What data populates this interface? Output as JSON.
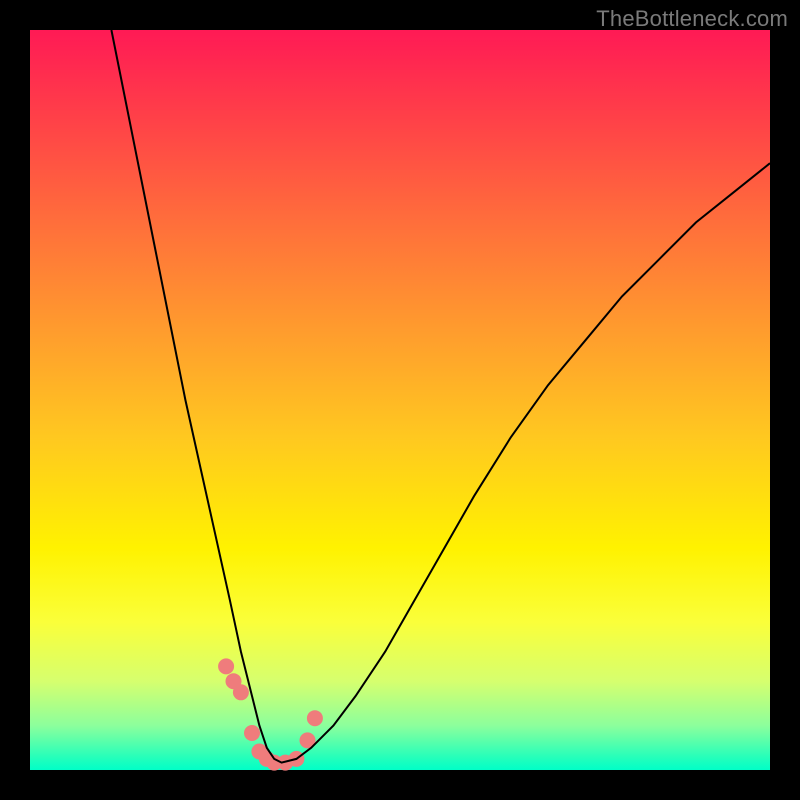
{
  "watermark": "TheBottleneck.com",
  "chart_data": {
    "type": "line",
    "title": "",
    "xlabel": "",
    "ylabel": "",
    "xlim": [
      0,
      100
    ],
    "ylim": [
      0,
      100
    ],
    "series": [
      {
        "name": "black-curve",
        "color": "#000000",
        "width": 2,
        "x": [
          11,
          13,
          15,
          17,
          19,
          21,
          23,
          25,
          27,
          28.5,
          30,
          31,
          32,
          33,
          34,
          36,
          38,
          41,
          44,
          48,
          52,
          56,
          60,
          65,
          70,
          75,
          80,
          85,
          90,
          95,
          100
        ],
        "y": [
          100,
          90,
          80,
          70,
          60,
          50,
          41,
          32,
          23,
          16,
          10,
          6,
          3,
          1.5,
          1,
          1.5,
          3,
          6,
          10,
          16,
          23,
          30,
          37,
          45,
          52,
          58,
          64,
          69,
          74,
          78,
          82
        ]
      },
      {
        "name": "pink-markers",
        "color": "#ef7c7c",
        "type": "scatter",
        "radius": 8,
        "x": [
          26.5,
          27.5,
          28.5,
          30.0,
          31.0,
          32.0,
          33.0,
          34.5,
          36.0,
          37.5,
          38.5
        ],
        "y": [
          14.0,
          12.0,
          10.5,
          5.0,
          2.5,
          1.5,
          1.0,
          1.0,
          1.5,
          4.0,
          7.0
        ]
      }
    ]
  }
}
